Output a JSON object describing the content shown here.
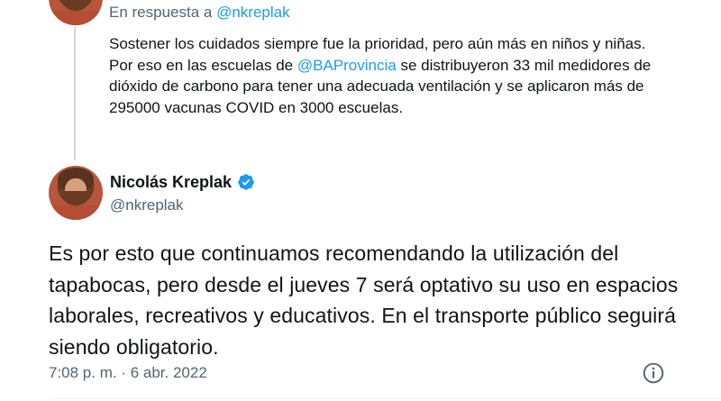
{
  "parent_tweet": {
    "reply_prefix": "En respuesta a",
    "reply_handle": "@nkreplak",
    "text_1": "Sostener los cuidados siempre fue la prioridad, pero aún más en niños y niñas. Por eso en las escuelas de",
    "mention": "@BAProvincia",
    "text_2": "se distribuyeron 33 mil medidores de dióxido de carbono para tener una adecuada ventilación y se aplicaron más de 295000 vacunas COVID en 3000 escuelas."
  },
  "tweet": {
    "display_name": "Nicolás Kreplak",
    "username": "@nkreplak",
    "text": "Es por esto que continuamos recomendando la utilización del tapabocas, pero desde el jueves 7 será optativo su uso en espacios laborales, recreativos y educativos. En el transporte público seguirá siendo obligatorio.",
    "timestamp": "7:08 p. m. · 6 abr. 2022"
  },
  "icons": {
    "verified": "verified-badge-icon",
    "info": "info-circle-icon"
  },
  "colors": {
    "link": "#1d9bf0",
    "secondary_text": "#536471",
    "primary_text": "#0f1419",
    "thread_line": "#cfd9de"
  }
}
